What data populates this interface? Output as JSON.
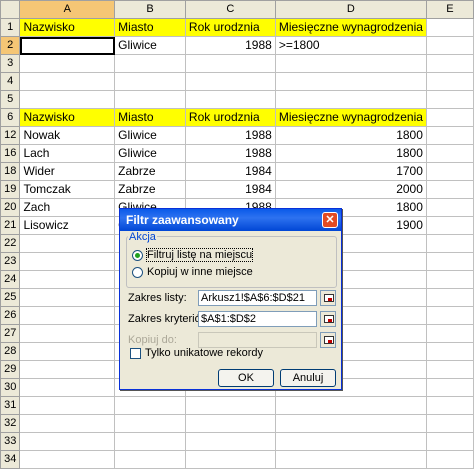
{
  "columns": [
    "A",
    "B",
    "C",
    "D",
    "E"
  ],
  "rows": [
    {
      "n": "1",
      "a": "Nazwisko",
      "b": "Miasto",
      "c": "Rok urodznia",
      "d": "Miesięczne wynagrodzenia",
      "style": "yellow"
    },
    {
      "n": "2",
      "a": "",
      "b": "Gliwice",
      "c": "1988",
      "d": ">=1800",
      "active": true,
      "dleft": true
    },
    {
      "n": "3"
    },
    {
      "n": "4"
    },
    {
      "n": "5"
    },
    {
      "n": "6",
      "a": "Nazwisko",
      "b": "Miasto",
      "c": "Rok urodznia",
      "d": "Miesięczne wynagrodzenia",
      "style": "yellow"
    },
    {
      "n": "12",
      "a": "Nowak",
      "b": "Gliwice",
      "c": "1988",
      "d": "1800"
    },
    {
      "n": "16",
      "a": "Lach",
      "b": "Gliwice",
      "c": "1988",
      "d": "1800"
    },
    {
      "n": "18",
      "a": "Wider",
      "b": "Zabrze",
      "c": "1984",
      "d": "1700"
    },
    {
      "n": "19",
      "a": "Tomczak",
      "b": "Zabrze",
      "c": "1984",
      "d": "2000"
    },
    {
      "n": "20",
      "a": "Zach",
      "b": "Gliwice",
      "c": "1988",
      "d": "1800"
    },
    {
      "n": "21",
      "a": "Lisowicz",
      "b": "Gliwice",
      "c": "1984",
      "d": "1900"
    },
    {
      "n": "22"
    },
    {
      "n": "23"
    },
    {
      "n": "24"
    },
    {
      "n": "25"
    },
    {
      "n": "26"
    },
    {
      "n": "27"
    },
    {
      "n": "28"
    },
    {
      "n": "29"
    },
    {
      "n": "30"
    },
    {
      "n": "31"
    },
    {
      "n": "32"
    },
    {
      "n": "33"
    },
    {
      "n": "34"
    }
  ],
  "dialog": {
    "title": "Filtr zaawansowany",
    "group_label": "Akcja",
    "radio1": "Filtruj listę na miejscu",
    "radio2": "Kopiuj w inne miejsce",
    "list_range_label": "Zakres listy:",
    "list_range_value": "Arkusz1!$A$6:$D$21",
    "criteria_label": "Zakres kryteriów:",
    "criteria_value": "$A$1:$D$2",
    "copy_to_label": "Kopiuj do:",
    "copy_to_value": "",
    "unique_label": "Tylko unikatowe rekordy",
    "ok_label": "OK",
    "cancel_label": "Anuluj"
  }
}
